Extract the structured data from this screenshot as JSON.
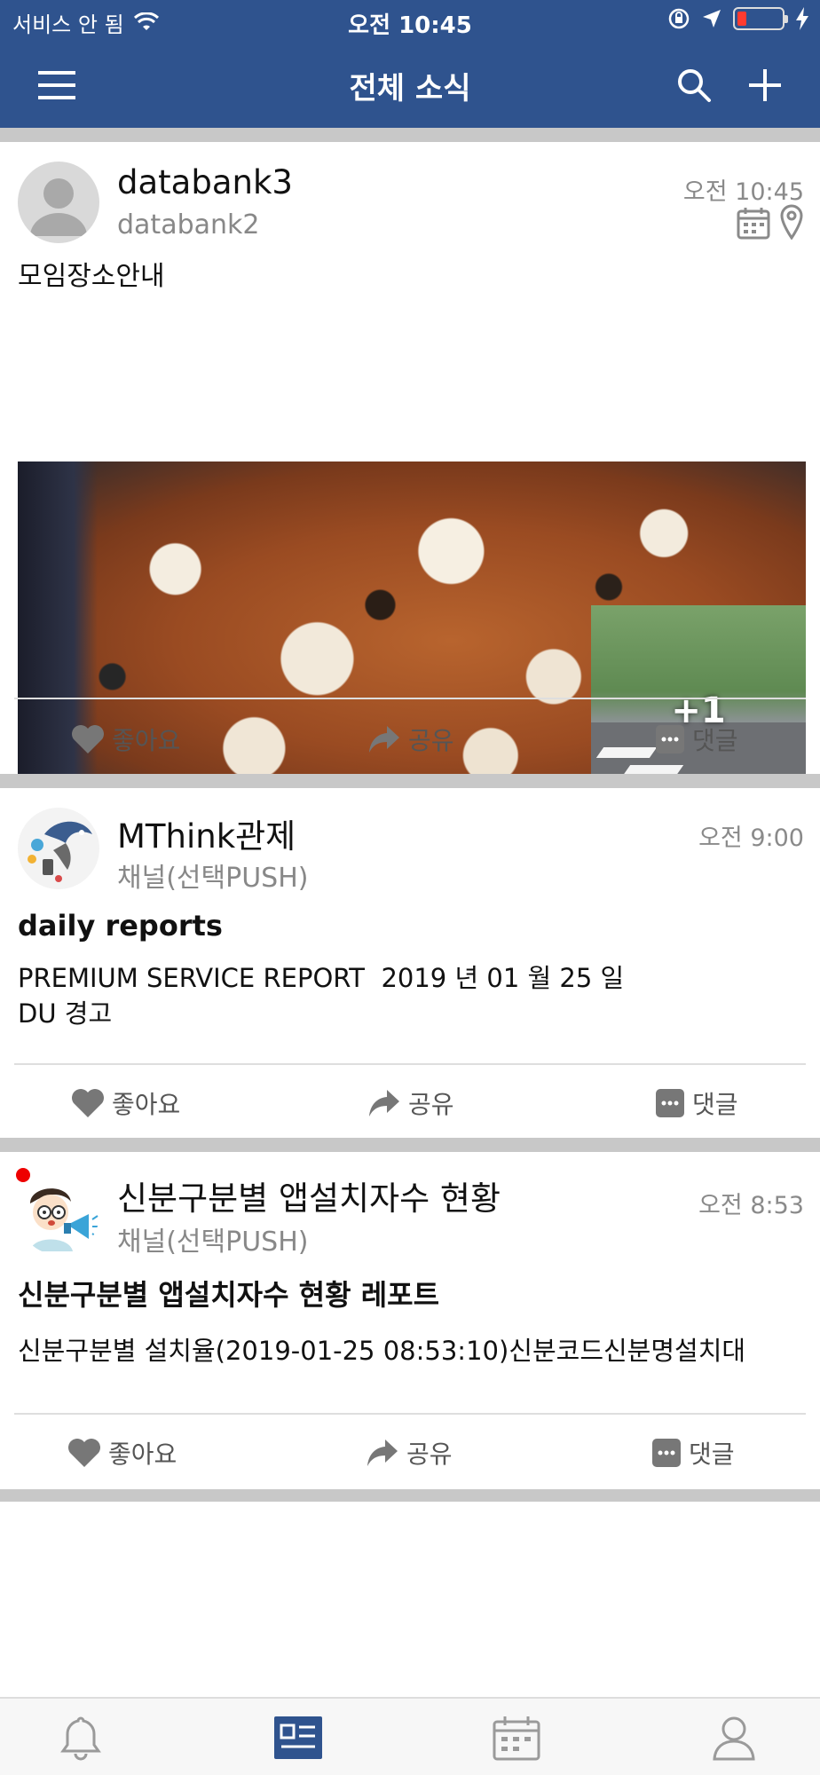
{
  "status_bar": {
    "carrier": "서비스 안 됨",
    "time": "오전 10:45"
  },
  "header": {
    "title": "전체 소식",
    "menu_icon": "hamburger-icon",
    "search_icon": "search-icon",
    "add_icon": "plus-icon",
    "background": "#2f538e"
  },
  "posts": [
    {
      "name": "databank3",
      "sub": "databank2",
      "time": "오전 10:45",
      "text": "모임장소안내",
      "extra_photo_count": "+1",
      "icons": [
        "calendar-icon",
        "location-pin-icon"
      ]
    },
    {
      "name": "MThink관제",
      "sub": "채널(선택PUSH)",
      "time": "오전 9:00",
      "title": "daily reports",
      "text": "PREMIUM SERVICE REPORT  2019 년 01 월 25 일\nDU 경고"
    },
    {
      "name": "신분구분별 앱설치자수 현황",
      "sub": "채널(선택PUSH)",
      "time": "오전 8:53",
      "title": "신분구분별 앱설치자수 현황 레포트",
      "text": "신분구분별 설치율(2019-01-25 08:53:10)신분코드신분명설치대",
      "unread": true
    }
  ],
  "actions": {
    "like": "좋아요",
    "share": "공유",
    "comment": "댓글"
  },
  "tabbar": {
    "items": [
      "bell-icon",
      "news-feed-icon",
      "calendar-icon",
      "profile-icon"
    ],
    "active_index": 1,
    "active_color": "#2f538e"
  }
}
